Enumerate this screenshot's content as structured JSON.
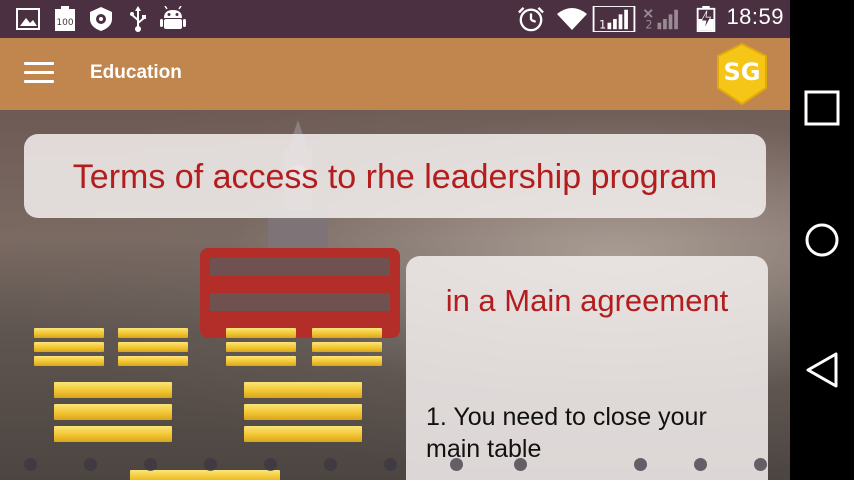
{
  "status_bar": {
    "time": "18:59",
    "icons": [
      "image-icon",
      "battery-100-icon",
      "shield-icon",
      "usb-icon",
      "android-icon",
      "alarm-icon",
      "wifi-icon",
      "signal-sim1-icon",
      "signal-sim2-icon",
      "battery-charging-icon"
    ],
    "battery_label": "100",
    "sim1_label": "1",
    "sim2_label": "2"
  },
  "app_bar": {
    "title": "Education",
    "logo_text": "SG",
    "colors": {
      "background": "#c0864e",
      "logo": "#f5c518"
    }
  },
  "content": {
    "title": "Terms of access to rhe leadership program",
    "main_heading": "in a Main agreement",
    "item_1": "1. You need to close your main table"
  },
  "colors": {
    "accent_text": "#b31d1d",
    "card": "#f0ecea",
    "status_bar": "#4a3040"
  },
  "navigation": {
    "recents_icon": "square-icon",
    "home_icon": "circle-icon",
    "back_icon": "triangle-back-icon"
  }
}
